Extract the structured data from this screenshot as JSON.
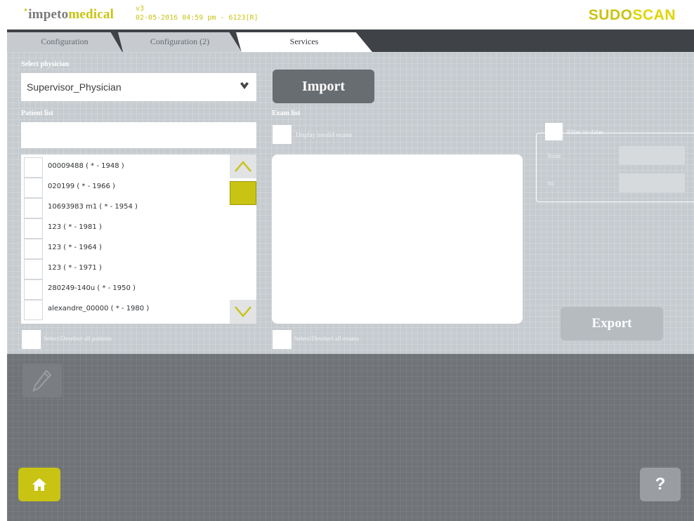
{
  "header": {
    "logo_prefix": "*",
    "logo_main": "impeto",
    "logo_accent": "medical",
    "version": "v3",
    "datetime": "02-05-2016 04:59 pm - 6123[R]",
    "brand_part1": "SUDO",
    "brand_part2": "SCAN"
  },
  "tabs": [
    {
      "label": "Configuration"
    },
    {
      "label": "Configuration (2)"
    },
    {
      "label": "Services",
      "active": true
    }
  ],
  "services": {
    "select_physician_label": "Select physician",
    "physician_value": "Supervisor_Physician",
    "import_label": "Import",
    "patient_list_label": "Patient list",
    "patient_search_value": "",
    "patients": [
      "00009488  ( * - 1948 )",
      "020199  ( * - 1966 )",
      "10693983 m1  ( * - 1954 )",
      "123  ( * - 1981 )",
      "123  ( * - 1964 )",
      "123  ( * - 1971 )",
      "280249-140u  ( * - 1950 )",
      "alexandre_00000  ( * - 1980 )"
    ],
    "select_all_patients_label": "Select/Deselect all patients",
    "exam_list_label": "Exam list",
    "display_invalid_label": "Display invalid exams",
    "select_all_exams_label": "Select/Deselect all exams",
    "filter_dates_label": "Filter on dates",
    "from_label": "from:",
    "to_label": "to:",
    "export_label": "Export"
  },
  "footer": {
    "help_label": "?"
  },
  "colors": {
    "accent": "#c9c313",
    "panel": "#c6cbd0",
    "footer": "#707478",
    "tabbar": "#3f4247"
  },
  "icons": [
    "chevron-down-icon",
    "arrow-up-icon",
    "arrow-down-icon",
    "pencil-icon",
    "home-icon"
  ]
}
